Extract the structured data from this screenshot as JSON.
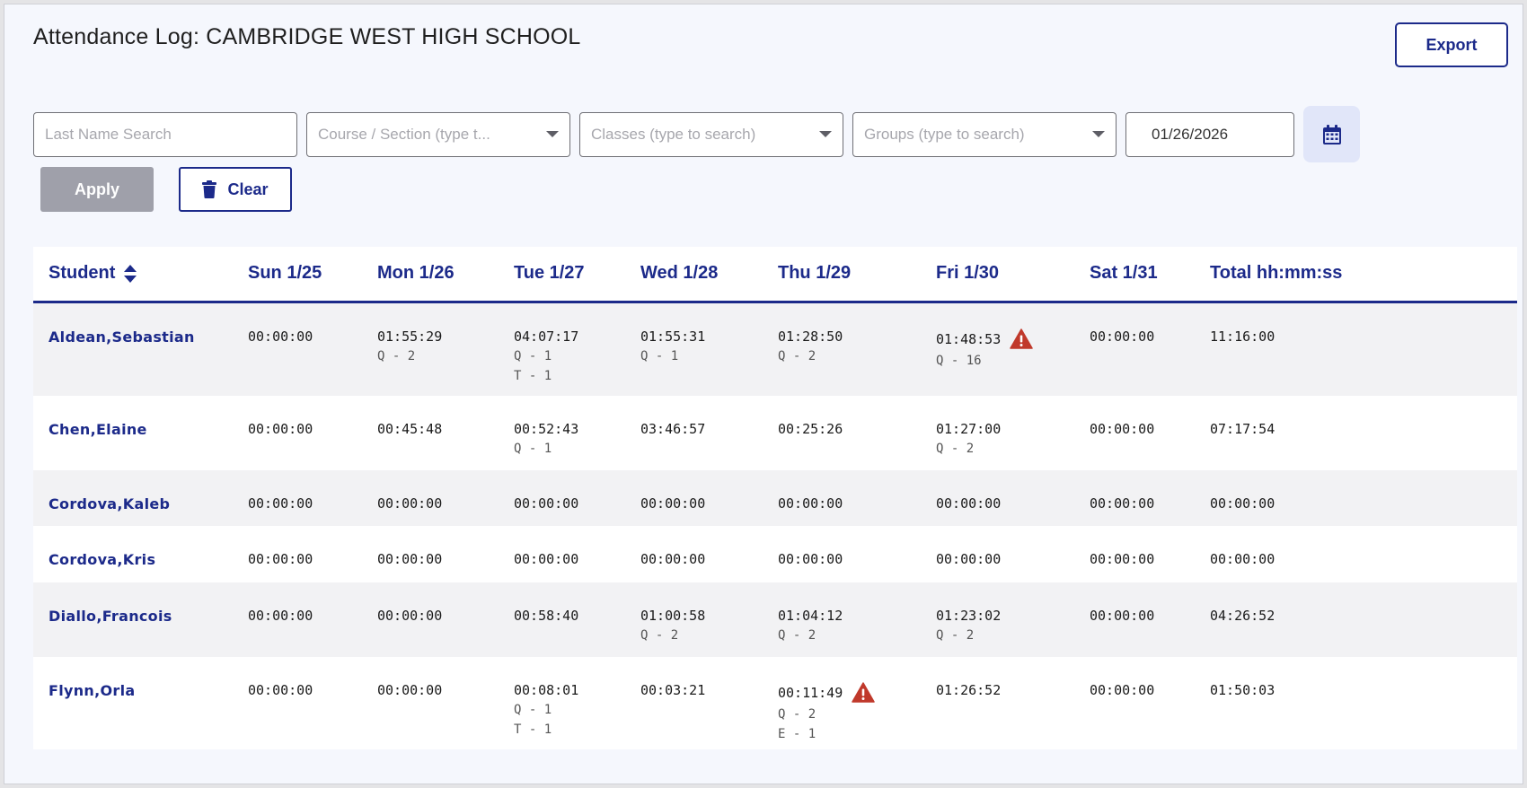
{
  "header": {
    "title": "Attendance Log: CAMBRIDGE WEST HIGH SCHOOL",
    "export_label": "Export"
  },
  "filters": {
    "last_name_placeholder": "Last Name Search",
    "course_placeholder": "Course / Section (type t...",
    "classes_placeholder": "Classes (type to search)",
    "groups_placeholder": "Groups (type to search)",
    "date_value": "01/26/2026",
    "apply_label": "Apply",
    "clear_label": "Clear"
  },
  "columns": [
    "Student",
    "Sun 1/25",
    "Mon 1/26",
    "Tue 1/27",
    "Wed 1/28",
    "Thu 1/29",
    "Fri 1/30",
    "Sat 1/31",
    "Total hh:mm:ss"
  ],
  "rows": [
    {
      "name": "Aldean,Sebastian",
      "days": [
        {
          "time": "00:00:00",
          "notes": []
        },
        {
          "time": "01:55:29",
          "notes": [
            "Q - 2"
          ]
        },
        {
          "time": "04:07:17",
          "notes": [
            "Q - 1",
            "T - 1"
          ]
        },
        {
          "time": "01:55:31",
          "notes": [
            "Q - 1"
          ]
        },
        {
          "time": "01:28:50",
          "notes": [
            "Q - 2"
          ]
        },
        {
          "time": "01:48:53",
          "notes": [
            "Q - 16"
          ],
          "warning": true
        },
        {
          "time": "00:00:00",
          "notes": []
        }
      ],
      "total": "11:16:00"
    },
    {
      "name": "Chen,Elaine",
      "days": [
        {
          "time": "00:00:00",
          "notes": []
        },
        {
          "time": "00:45:48",
          "notes": []
        },
        {
          "time": "00:52:43",
          "notes": [
            "Q - 1"
          ]
        },
        {
          "time": "03:46:57",
          "notes": []
        },
        {
          "time": "00:25:26",
          "notes": []
        },
        {
          "time": "01:27:00",
          "notes": [
            "Q - 2"
          ]
        },
        {
          "time": "00:00:00",
          "notes": []
        }
      ],
      "total": "07:17:54"
    },
    {
      "name": "Cordova,Kaleb",
      "days": [
        {
          "time": "00:00:00",
          "notes": []
        },
        {
          "time": "00:00:00",
          "notes": []
        },
        {
          "time": "00:00:00",
          "notes": []
        },
        {
          "time": "00:00:00",
          "notes": []
        },
        {
          "time": "00:00:00",
          "notes": []
        },
        {
          "time": "00:00:00",
          "notes": []
        },
        {
          "time": "00:00:00",
          "notes": []
        }
      ],
      "total": "00:00:00"
    },
    {
      "name": "Cordova,Kris",
      "days": [
        {
          "time": "00:00:00",
          "notes": []
        },
        {
          "time": "00:00:00",
          "notes": []
        },
        {
          "time": "00:00:00",
          "notes": []
        },
        {
          "time": "00:00:00",
          "notes": []
        },
        {
          "time": "00:00:00",
          "notes": []
        },
        {
          "time": "00:00:00",
          "notes": []
        },
        {
          "time": "00:00:00",
          "notes": []
        }
      ],
      "total": "00:00:00"
    },
    {
      "name": "Diallo,Francois",
      "days": [
        {
          "time": "00:00:00",
          "notes": []
        },
        {
          "time": "00:00:00",
          "notes": []
        },
        {
          "time": "00:58:40",
          "notes": []
        },
        {
          "time": "01:00:58",
          "notes": [
            "Q - 2"
          ]
        },
        {
          "time": "01:04:12",
          "notes": [
            "Q - 2"
          ]
        },
        {
          "time": "01:23:02",
          "notes": [
            "Q - 2"
          ]
        },
        {
          "time": "00:00:00",
          "notes": []
        }
      ],
      "total": "04:26:52"
    },
    {
      "name": "Flynn,Orla",
      "days": [
        {
          "time": "00:00:00",
          "notes": []
        },
        {
          "time": "00:00:00",
          "notes": []
        },
        {
          "time": "00:08:01",
          "notes": [
            "Q - 1",
            "T - 1"
          ]
        },
        {
          "time": "00:03:21",
          "notes": []
        },
        {
          "time": "00:11:49",
          "notes": [
            "Q - 2",
            "E - 1"
          ],
          "warning": true
        },
        {
          "time": "01:26:52",
          "notes": []
        },
        {
          "time": "00:00:00",
          "notes": []
        }
      ],
      "total": "01:50:03"
    }
  ],
  "colors": {
    "accent": "#1c2a8a",
    "warning": "#c0392b",
    "apply_disabled": "#9fa0aa"
  }
}
